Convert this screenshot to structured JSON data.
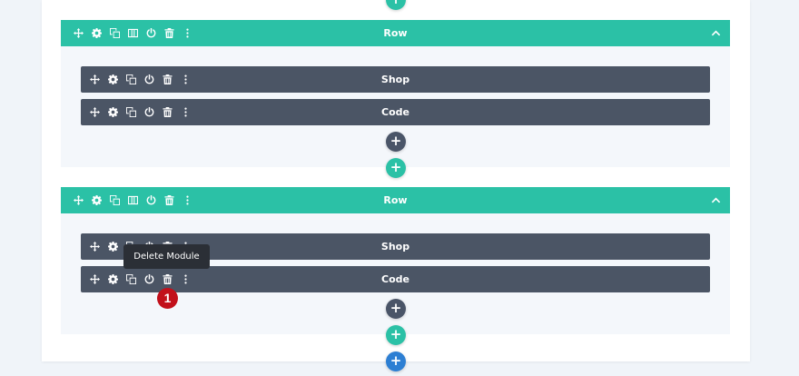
{
  "colors": {
    "row_bar": "#2bc1a6",
    "module_bar": "#4b5565",
    "add_section": "#2d7fd3",
    "badge": "#c2101b"
  },
  "add_symbol": "+",
  "rows": [
    {
      "title": "Row",
      "modules": [
        {
          "label": "Shop"
        },
        {
          "label": "Code"
        }
      ]
    },
    {
      "title": "Row",
      "modules": [
        {
          "label": "Shop"
        },
        {
          "label": "Code"
        }
      ]
    }
  ],
  "tooltip": {
    "text": "Delete Module"
  },
  "badge": {
    "number": "1"
  }
}
